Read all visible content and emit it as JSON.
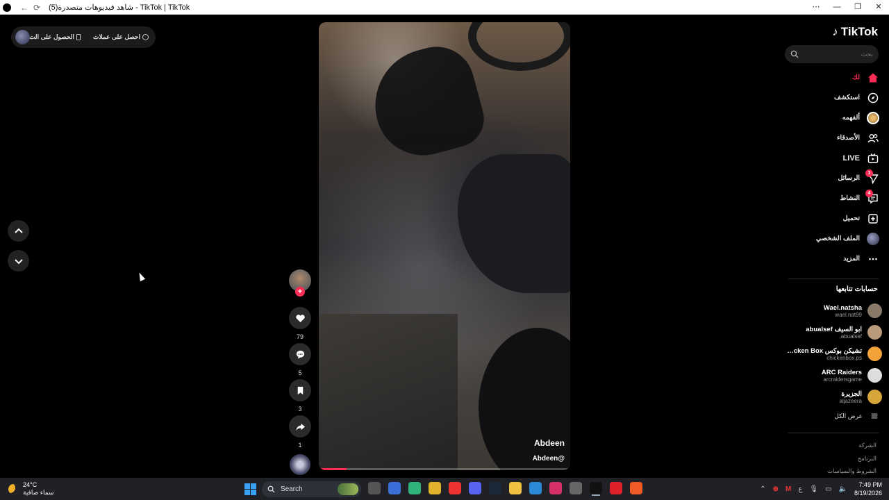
{
  "window": {
    "title": "شاهد فيديوهات متصدرة(5) - TikTok | TikTok",
    "back_glyph": "←",
    "reload_glyph": "⟳",
    "controls": [
      "⋯",
      "—",
      "❐",
      "✕"
    ]
  },
  "topbar": {
    "item_coins": "احصل على عملات",
    "item_app": "الحصول على الت..."
  },
  "video": {
    "author": "Abdeen",
    "handle": "Abdeen@",
    "progress": 0.11
  },
  "actions": {
    "like_count": "79",
    "comment_count": "5",
    "save_count": "3",
    "share_count": "1",
    "follow_plus": "+"
  },
  "sidebar": {
    "logo": "TikTok",
    "search_placeholder": "بحث",
    "menu": [
      {
        "label": "لك",
        "icon": "home-icon",
        "active": true
      },
      {
        "label": "استكشف",
        "icon": "compass-icon"
      },
      {
        "label": "ألفهمه",
        "icon": "avatar-ring-icon"
      },
      {
        "label": "الأصدقاء",
        "icon": "friends-icon"
      },
      {
        "label": "LIVE",
        "icon": "live-icon"
      },
      {
        "label": "الرسائل",
        "icon": "messages-icon",
        "badge": "1"
      },
      {
        "label": "النشاط",
        "icon": "activity-icon",
        "badge": "4"
      },
      {
        "label": "تحميل",
        "icon": "upload-icon"
      },
      {
        "label": "الملف الشخصي",
        "icon": "profile-avatar-icon"
      },
      {
        "label": "المزيد",
        "icon": "more-icon"
      }
    ],
    "following_title": "حسابات تتابعها",
    "following": [
      {
        "name": "Wael.natsha",
        "user": "wael.nat99",
        "color": "#8a7a6a"
      },
      {
        "name": "ابو السيف abualsef",
        "user": "abualsef.",
        "color": "#b99a7a"
      },
      {
        "name": "تشيكن بوكس Chicken Box",
        "user": "chickenbox.ps",
        "color": "#f3a23a"
      },
      {
        "name": "ARC Raiders",
        "user": "arcraidersgame",
        "color": "#ddd"
      },
      {
        "name": "الجزيرة",
        "user": "aljazeera",
        "color": "#d6a63a"
      }
    ],
    "see_all": "عرض الكل",
    "footer": [
      "الشركة",
      "البرنامج",
      "الشروط والسياسات"
    ]
  },
  "taskbar": {
    "temp": "24°C",
    "weather": "سماء صافية",
    "search": "Search",
    "time": "7:49 PM",
    "date": "8/19/2026",
    "lang": "ع",
    "apps": [
      {
        "name": "task-view-icon",
        "color": "#555"
      },
      {
        "name": "store-icon",
        "color": "#3a6fd8"
      },
      {
        "name": "app-icon",
        "color": "#2fb37a"
      },
      {
        "name": "chrome-icon",
        "color": "#e0b12a"
      },
      {
        "name": "youtube-icon",
        "color": "#e33"
      },
      {
        "name": "discord-icon",
        "color": "#5865f2"
      },
      {
        "name": "steam-icon",
        "color": "#1b2838"
      },
      {
        "name": "explorer-icon",
        "color": "#f0c040"
      },
      {
        "name": "app2-icon",
        "color": "#2a8ad8"
      },
      {
        "name": "instagram-icon",
        "color": "#d6306a"
      },
      {
        "name": "app3-icon",
        "color": "#666"
      },
      {
        "name": "tiktok-icon",
        "color": "#111"
      },
      {
        "name": "opera-icon",
        "color": "#e0202a"
      },
      {
        "name": "brave-icon",
        "color": "#f05a24"
      }
    ]
  }
}
